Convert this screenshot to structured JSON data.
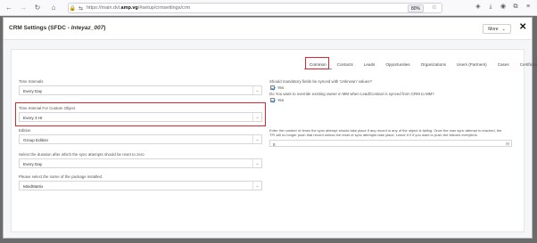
{
  "browser": {
    "url_prefix": "https://main.dvl.",
    "url_domain": "amp.vg",
    "url_suffix": "/#setup/crmsettings/crm",
    "zoom": "80%"
  },
  "modal": {
    "title_prefix": "CRM Settings (SFDC - ",
    "title_org": "Inteyaz_007",
    "title_suffix": ")",
    "more_label": "More",
    "close_symbol": "✕"
  },
  "tabs": [
    "Common",
    "Contacts",
    "Leads",
    "Opportunities",
    "Organizations",
    "Users (Partners)",
    "Cases",
    "Certifications"
  ],
  "active_tab": "Common",
  "left_fields": {
    "time_intervals_label": "Time Intervals",
    "time_intervals_value": "Every Day",
    "custom_object_label": "Time Interval For Custom Object",
    "custom_object_value": "Every 3 Hr",
    "edition_label": "Edition",
    "edition_value": "Group Edition",
    "reset_label": "Select the duration after which the sync attempts should be reset to zero",
    "reset_value": "Every Day",
    "package_label": "Please select the name of the package installed.",
    "package_value": "MindMatrix"
  },
  "right_fields": {
    "mandatory_q": "Should mandatory fields be synced with 'Unknown' values?",
    "mandatory_answer": "Yes",
    "override_q": "Do You want to override existing owner in MM when Lead/Contact is synced from CRM to MM?",
    "override_answer": "Yes",
    "retry_line1": "Enter the number of times the sync attempt should take place if any record in any of the object is failing. Once the max sync attempt is reached, the",
    "retry_line2": "TPI will no longer push that record unless the reset of sync attempts take place. Leave it 0 if you want to push the failures everytime.",
    "retry_value": "0"
  }
}
